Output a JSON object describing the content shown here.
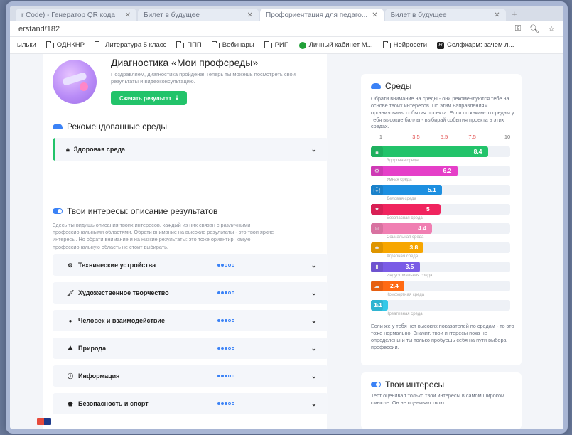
{
  "browser": {
    "tabs": [
      {
        "title": "r Code) - Генератор QR кода",
        "active": false
      },
      {
        "title": "Билет в будущее",
        "active": false
      },
      {
        "title": "Профориентация для педаго...",
        "active": true
      },
      {
        "title": "Билет в будущее",
        "active": false
      }
    ],
    "url": "erstand/182",
    "bookmarks": [
      "ыльки",
      "ОДНКНР",
      "Литература 5 класс",
      "ППП",
      "Вебинары",
      "РИП",
      "Личный кабинет М...",
      "Нейросети",
      "Селфхарм: зачем л..."
    ]
  },
  "hero": {
    "title": "Диагностика «Мои профсреды»",
    "subtitle": "Поздравляем, диагностика пройдена! Теперь ты можешь посмотреть свои результаты и видеоконсультацию.",
    "download_label": "Скачать результат"
  },
  "recommended": {
    "title": "Рекомендованные среды",
    "env_name": "Здоровая среда"
  },
  "interests": {
    "title": "Твои интересы: описание результатов",
    "description": "Здесь ты видишь описания твоих интересов, каждый из них связан с различными профессиональными областями. Обрати внимание на высокие результаты - это твои яркие интересы. Но обрати внимание и на низкие результаты: это тоже ориентир, какую профессиональную область не стоит выбирать.",
    "rows": [
      {
        "label": "Технические устройства",
        "icon": "gear-icon",
        "level": 2
      },
      {
        "label": "Художественное творчество",
        "icon": "palette-icon",
        "level": 3
      },
      {
        "label": "Человек и взаимодействие",
        "icon": "chat-icon",
        "level": 3
      },
      {
        "label": "Природа",
        "icon": "mountain-icon",
        "level": 3
      },
      {
        "label": "Информация",
        "icon": "info-icon",
        "level": 3
      },
      {
        "label": "Безопасность и спорт",
        "icon": "shield-icon",
        "level": 3
      }
    ]
  },
  "environments": {
    "title": "Среды",
    "description": "Обрати внимание на среды - они рекомендуются тебе на основе твоих интересов. По этим направлениям организованы события проекта. Если по каким-то средам у тебя высокие баллы - выбирай события проекта в этих средах.",
    "ticks": [
      "1",
      "3.5",
      "5.5",
      "7.5",
      "10"
    ],
    "footer": "Если же у тебя нет высоких показателей по средам - то это тоже нормально. Значит, твои интересы пока не определены и ты только пробуешь себя на пути выбора профессии."
  },
  "chart_data": {
    "type": "bar",
    "categories": [
      "Здоровая среда",
      "Умная среда",
      "Деловая среда",
      "Безопасная среда",
      "Социальная среда",
      "Аграрная среда",
      "Индустриальная среда",
      "Комфортная среда",
      "Креативная среда"
    ],
    "values": [
      8.4,
      6.2,
      5.1,
      5,
      4.4,
      3.8,
      3.5,
      2.4,
      1.1
    ],
    "colors": [
      "#22c36a",
      "#e53fc8",
      "#1d8fe0",
      "#f0245e",
      "#f07fb2",
      "#f7a600",
      "#7a5ce6",
      "#ff6a13",
      "#35c8e8"
    ],
    "ylim": [
      1,
      10
    ]
  },
  "your_interests": {
    "title": "Твои интересы",
    "description": "Тест оценивал только твои интересы в самом широком смысле. Он не оценивал твою..."
  }
}
